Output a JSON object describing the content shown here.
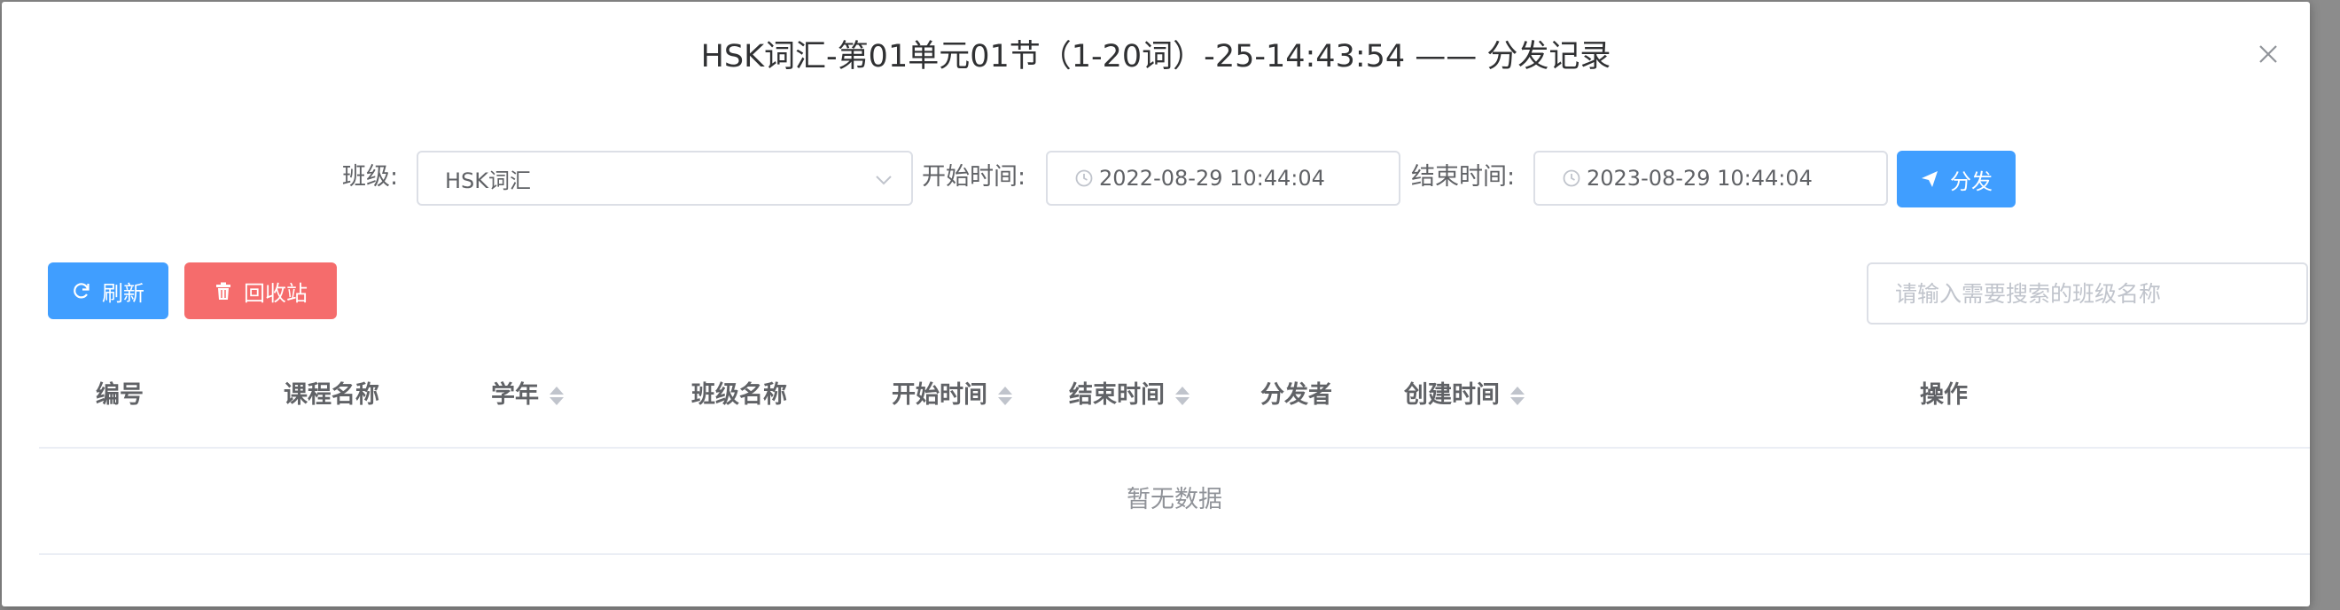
{
  "dialog": {
    "title": "HSK词汇-第01单元01节（1-20词）-25-14:43:54 —— 分发记录"
  },
  "filters": {
    "class_label": "班级:",
    "class_value": "HSK词汇",
    "start_label": "开始时间:",
    "start_value": "2022-08-29 10:44:04",
    "end_label": "结束时间:",
    "end_value": "2023-08-29 10:44:04",
    "distribute_label": "分发"
  },
  "toolbar": {
    "refresh_label": "刷新",
    "recycle_label": "回收站",
    "search_placeholder": "请输入需要搜索的班级名称"
  },
  "table": {
    "columns": [
      "编号",
      "课程名称",
      "学年",
      "班级名称",
      "开始时间",
      "结束时间",
      "分发者",
      "创建时间",
      "操作"
    ],
    "empty_text": "暂无数据"
  },
  "colors": {
    "primary": "#409eff",
    "danger": "#f56c6c",
    "border": "#dcdfe6"
  },
  "icons": {
    "close": "close-icon",
    "dropdown": "chevron-down-icon",
    "clock": "clock-icon",
    "send": "send-icon",
    "refresh": "refresh-icon",
    "trash": "trash-icon",
    "sort": "sort-caret-icon"
  }
}
